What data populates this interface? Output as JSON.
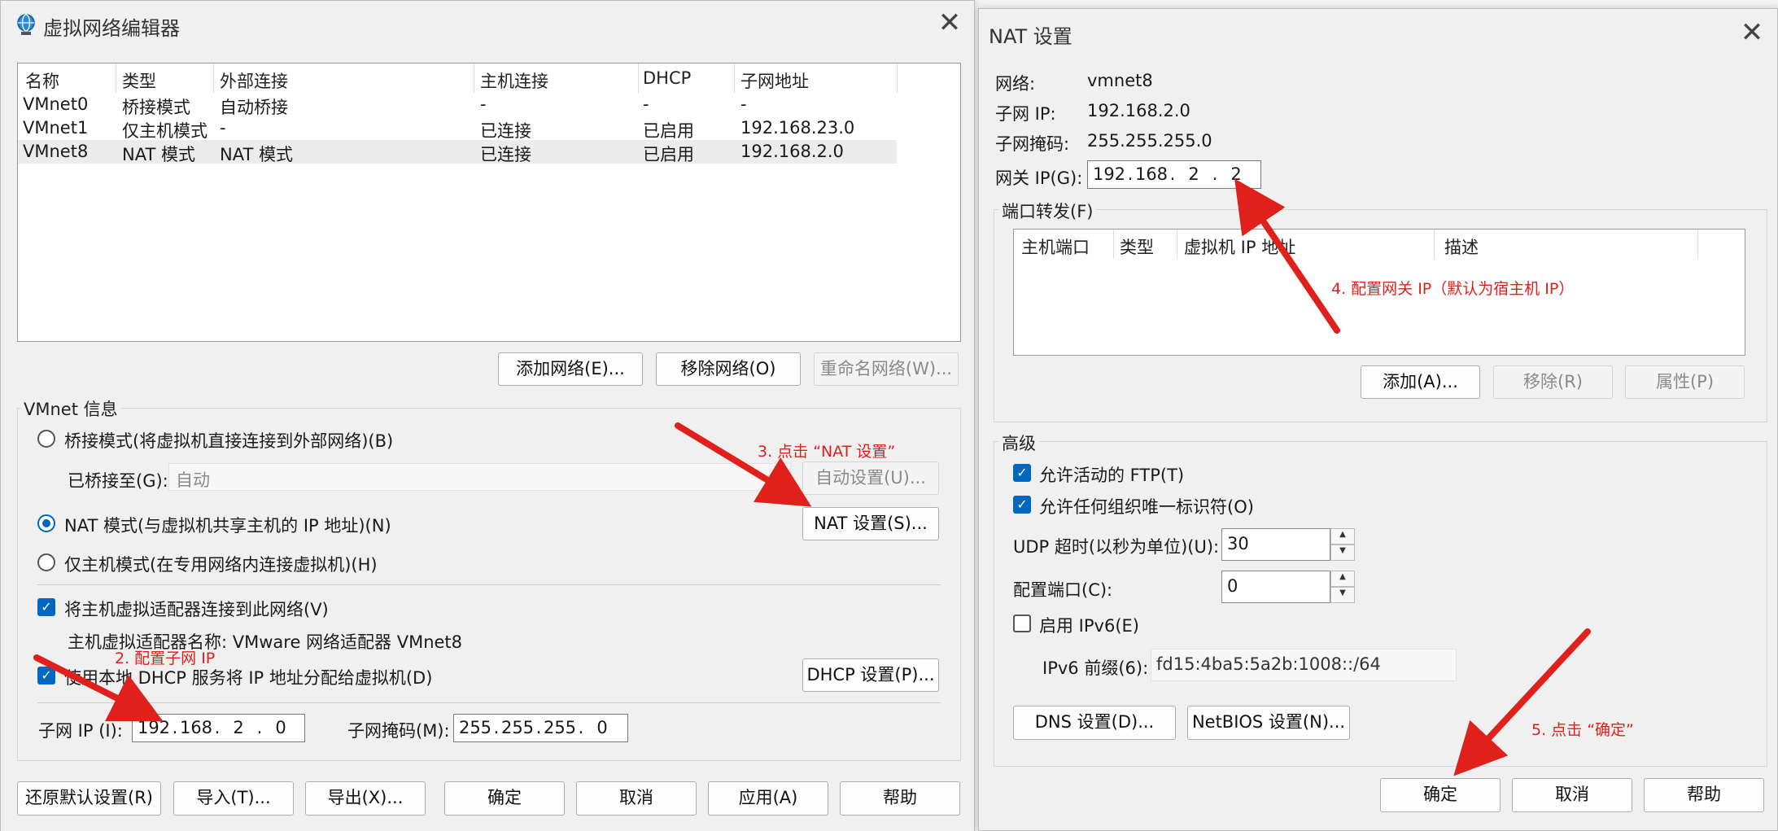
{
  "left": {
    "title": "虚拟网络编辑器",
    "columns": [
      "名称",
      "类型",
      "外部连接",
      "主机连接",
      "DHCP",
      "子网地址"
    ],
    "rows": [
      [
        "VMnet0",
        "桥接模式",
        "自动桥接",
        "-",
        "-",
        "-"
      ],
      [
        "VMnet1",
        "仅主机模式",
        "-",
        "已连接",
        "已启用",
        "192.168.23.0"
      ],
      [
        "VMnet8",
        "NAT 模式",
        "NAT 模式",
        "已连接",
        "已启用",
        "192.168.2.0"
      ]
    ],
    "add_network": "添加网络(E)...",
    "remove_network": "移除网络(O)",
    "rename_network": "重命名网络(W)...",
    "vmnet_info": "VMnet 信息",
    "bridge_mode": "桥接模式(将虚拟机直接连接到外部网络)(B)",
    "bridged_to_label": "已桥接至(G):",
    "bridged_to_value": "自动",
    "auto_settings": "自动设置(U)...",
    "nat_mode": "NAT 模式(与虚拟机共享主机的 IP 地址)(N)",
    "nat_settings": "NAT 设置(S)...",
    "host_only_mode": "仅主机模式(在专用网络内连接虚拟机)(H)",
    "connect_adapter": "将主机虚拟适配器连接到此网络(V)",
    "adapter_name": "主机虚拟适配器名称: VMware 网络适配器 VMnet8",
    "use_dhcp": "使用本地 DHCP 服务将 IP 地址分配给虚拟机(D)",
    "dhcp_settings": "DHCP 设置(P)...",
    "subnet_ip_label": "子网 IP (I):",
    "subnet_ip": [
      "192",
      "168",
      "2",
      "0"
    ],
    "subnet_mask_label": "子网掩码(M):",
    "subnet_mask": [
      "255",
      "255",
      "255",
      "0"
    ],
    "restore_defaults": "还原默认设置(R)",
    "import": "导入(T)...",
    "export": "导出(X)...",
    "ok": "确定",
    "cancel": "取消",
    "apply": "应用(A)",
    "help": "帮助"
  },
  "right": {
    "title": "NAT 设置",
    "network_label": "网络:",
    "network_value": "vmnet8",
    "subnet_ip_label": "子网 IP:",
    "subnet_ip_value": "192.168.2.0",
    "subnet_mask_label": "子网掩码:",
    "subnet_mask_value": "255.255.255.0",
    "gateway_label": "网关 IP(G):",
    "gateway_ip": [
      "192",
      "168",
      "2",
      "2"
    ],
    "port_forwarding": "端口转发(F)",
    "pf_columns": [
      "主机端口",
      "类型",
      "虚拟机 IP 地址",
      "描述"
    ],
    "add": "添加(A)...",
    "remove": "移除(R)",
    "properties": "属性(P)",
    "advanced": "高级",
    "allow_ftp": "允许活动的 FTP(T)",
    "allow_oui": "允许任何组织唯一标识符(O)",
    "udp_timeout_label": "UDP 超时(以秒为单位)(U):",
    "udp_timeout_value": "30",
    "config_port_label": "配置端口(C):",
    "config_port_value": "0",
    "enable_ipv6": "启用 IPv6(E)",
    "ipv6_prefix_label": "IPv6 前缀(6):",
    "ipv6_prefix_value": "fd15:4ba5:5a2b:1008::/64",
    "dns_settings": "DNS 设置(D)...",
    "netbios_settings": "NetBIOS 设置(N)...",
    "ok": "确定",
    "cancel": "取消",
    "help": "帮助"
  },
  "annotations": {
    "step2": "2. 配置子网 IP",
    "step3": "3. 点击 “NAT 设置”",
    "step4": "4. 配置网关 IP（默认为宿主机 IP）",
    "step5": "5. 点击 “确定”"
  },
  "colors": {
    "accent": "#0067c0",
    "annotation": "#e0201b"
  }
}
